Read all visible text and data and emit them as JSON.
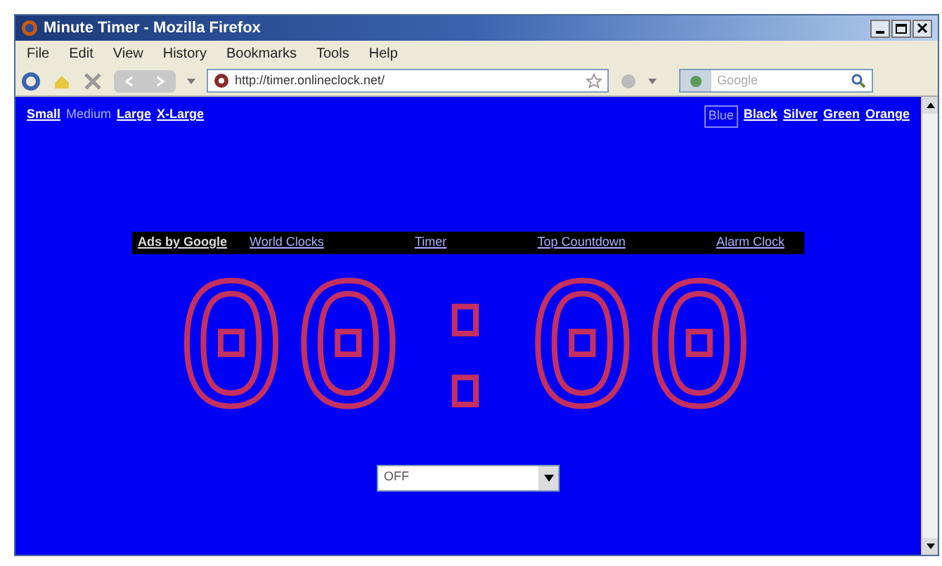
{
  "window": {
    "title": "Minute Timer - Mozilla Firefox"
  },
  "menu": [
    "File",
    "Edit",
    "View",
    "History",
    "Bookmarks",
    "Tools",
    "Help"
  ],
  "address": {
    "value": "http://timer.onlineclock.net/"
  },
  "search": {
    "placeholder": "Google"
  },
  "sizes": [
    {
      "label": "Small",
      "selected": false
    },
    {
      "label": "Medium",
      "selected": true
    },
    {
      "label": "Large",
      "selected": false
    },
    {
      "label": "X-Large",
      "selected": false
    }
  ],
  "colors": [
    {
      "label": "Blue",
      "selected": true
    },
    {
      "label": "Black",
      "selected": false
    },
    {
      "label": "Silver",
      "selected": false
    },
    {
      "label": "Green",
      "selected": false
    },
    {
      "label": "Orange",
      "selected": false
    }
  ],
  "ad_bar": {
    "title": "Ads by Google",
    "links": [
      "World Clocks",
      "Timer",
      "Top Countdown",
      "Alarm Clock"
    ]
  },
  "display": "00:00",
  "select": {
    "value": "OFF"
  }
}
